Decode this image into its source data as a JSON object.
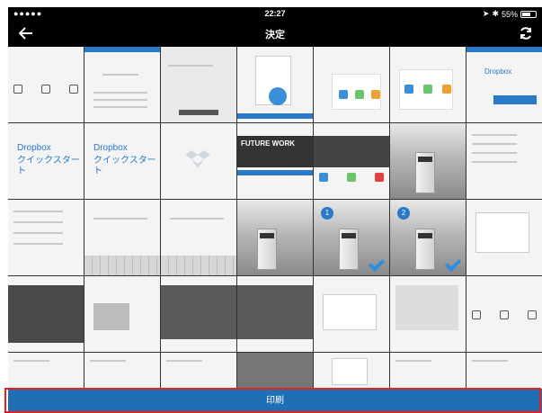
{
  "status_bar": {
    "carrier": "●●●●● ",
    "time": "22:27",
    "battery": "55%"
  },
  "nav": {
    "title": "決定",
    "back_icon": "arrow-left-icon",
    "refresh_icon": "refresh-icon"
  },
  "thumbnails": {
    "dropbox_title": "Dropbox",
    "dropbox_subtitle": "クイックスタート",
    "future_work": "FUTURE WORK",
    "badge_1": "1",
    "badge_2": "2"
  },
  "footer": {
    "print_label": "印刷"
  }
}
